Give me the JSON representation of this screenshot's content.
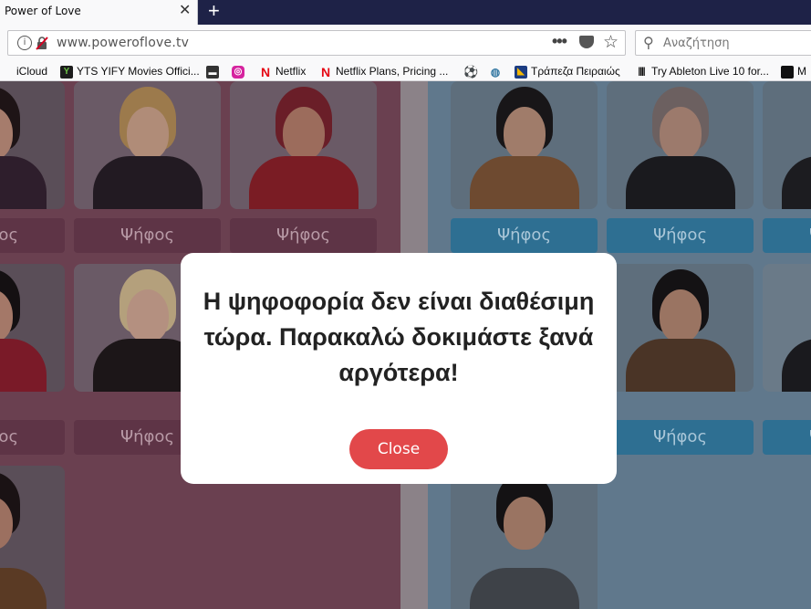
{
  "browser": {
    "tab_title": "Power of Love",
    "tab_close": "✕",
    "new_tab": "+",
    "url": "www.poweroflove.tv",
    "search_placeholder": "Αναζήτηση"
  },
  "bookmarks": [
    {
      "label": "iCloud",
      "icon": "apple-icon"
    },
    {
      "label": "YTS YIFY Movies Offici...",
      "icon": "yts-icon"
    },
    {
      "label": "",
      "icon": "bookmark-icon"
    },
    {
      "label": "",
      "icon": "instagram-icon"
    },
    {
      "label": "Netflix",
      "icon": "netflix-icon"
    },
    {
      "label": "Netflix Plans, Pricing ...",
      "icon": "netflix-icon"
    },
    {
      "label": "",
      "icon": "soccer-ball-icon"
    },
    {
      "label": "",
      "icon": "bookmark-icon"
    },
    {
      "label": "Τράπεζα Πειραιώς",
      "icon": "piraeus-bank-icon"
    },
    {
      "label": "Try Ableton Live 10 for...",
      "icon": "ableton-icon"
    },
    {
      "label": "M",
      "icon": "bookmark-icon"
    }
  ],
  "page": {
    "vote_label": "Ψήφος",
    "colors": {
      "left_panel": "#6a4050",
      "right_panel": "#60788c",
      "vote_pink": "#5e3446",
      "vote_blue": "#2e6f92"
    }
  },
  "modal": {
    "message": "Η ψηφοφορία δεν είναι διαθέσιμη τώρα. Παρακαλώ δοκιμάστε ξανά αργότερα!",
    "close_label": "Close",
    "accent": "#e2484a"
  }
}
